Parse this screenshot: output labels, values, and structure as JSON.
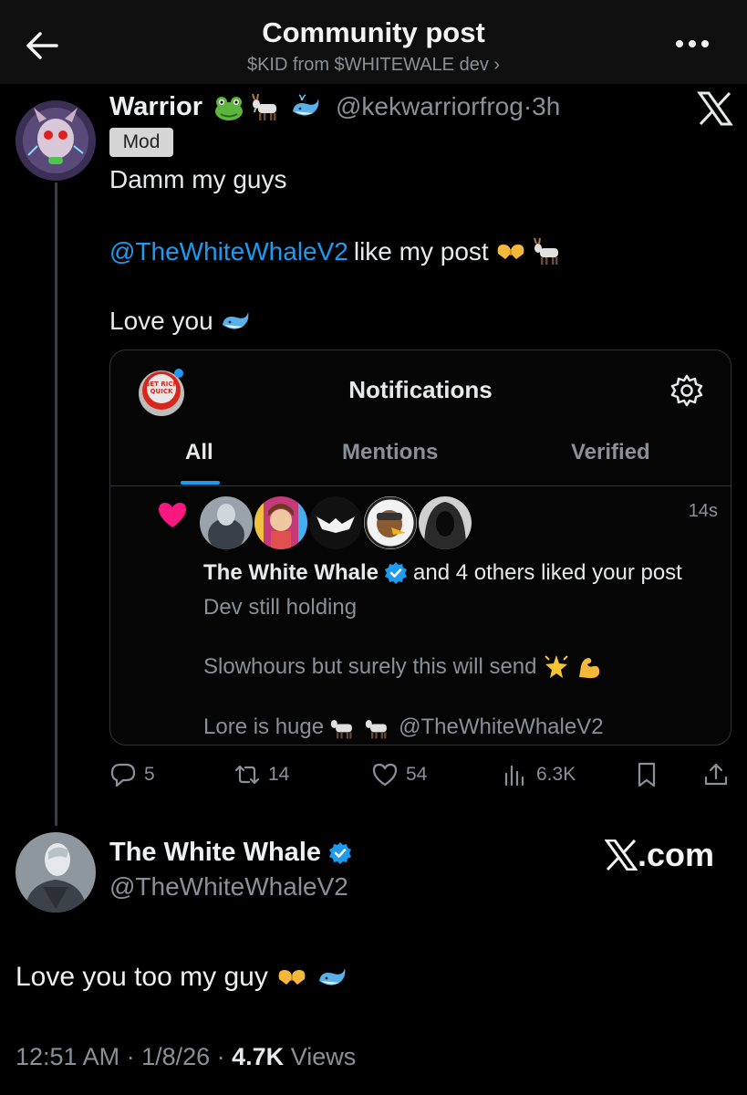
{
  "header": {
    "title": "Community post",
    "subtitle": "$KID from $WHITEWALE dev ›"
  },
  "post": {
    "author_name": "Warrior",
    "handle": "@kekwarriorfrog",
    "time_sep": "·",
    "time": "3h",
    "badge": "Mod",
    "line1": "Damm my guys",
    "mention": "@TheWhiteWhaleV2",
    "line2_rest": "like my post",
    "line3": "Love you",
    "emoji_icons": [
      "frog-emoji",
      "goat-emoji",
      "whale-emoji"
    ]
  },
  "card": {
    "title": "Notifications",
    "tabs": [
      "All",
      "Mentions",
      "Verified"
    ],
    "active_tab": "All",
    "time": "14s",
    "liker_name": "The White Whale",
    "liker_rest": "and 4 others liked your post",
    "quote_line1": "Dev still holding",
    "quote_line2": "Slowhours but surely this will send",
    "quote_line3_text": "Lore is huge",
    "quote_line3_mention": "@TheWhiteWhaleV2"
  },
  "actions": {
    "replies": "5",
    "reposts": "14",
    "likes": "54",
    "views": "6.3K"
  },
  "reply": {
    "author_name": "The White Whale",
    "handle": "@TheWhiteWhaleV2",
    "brand": ".com",
    "text": "Love you too my guy",
    "timestamp": "12:51 AM · 1/8/26 · ",
    "views_count": "4.7K",
    "views_label": " Views"
  },
  "colors": {
    "accent": "#1d9bf0",
    "muted": "#8b9096",
    "pink": "#f91880"
  }
}
